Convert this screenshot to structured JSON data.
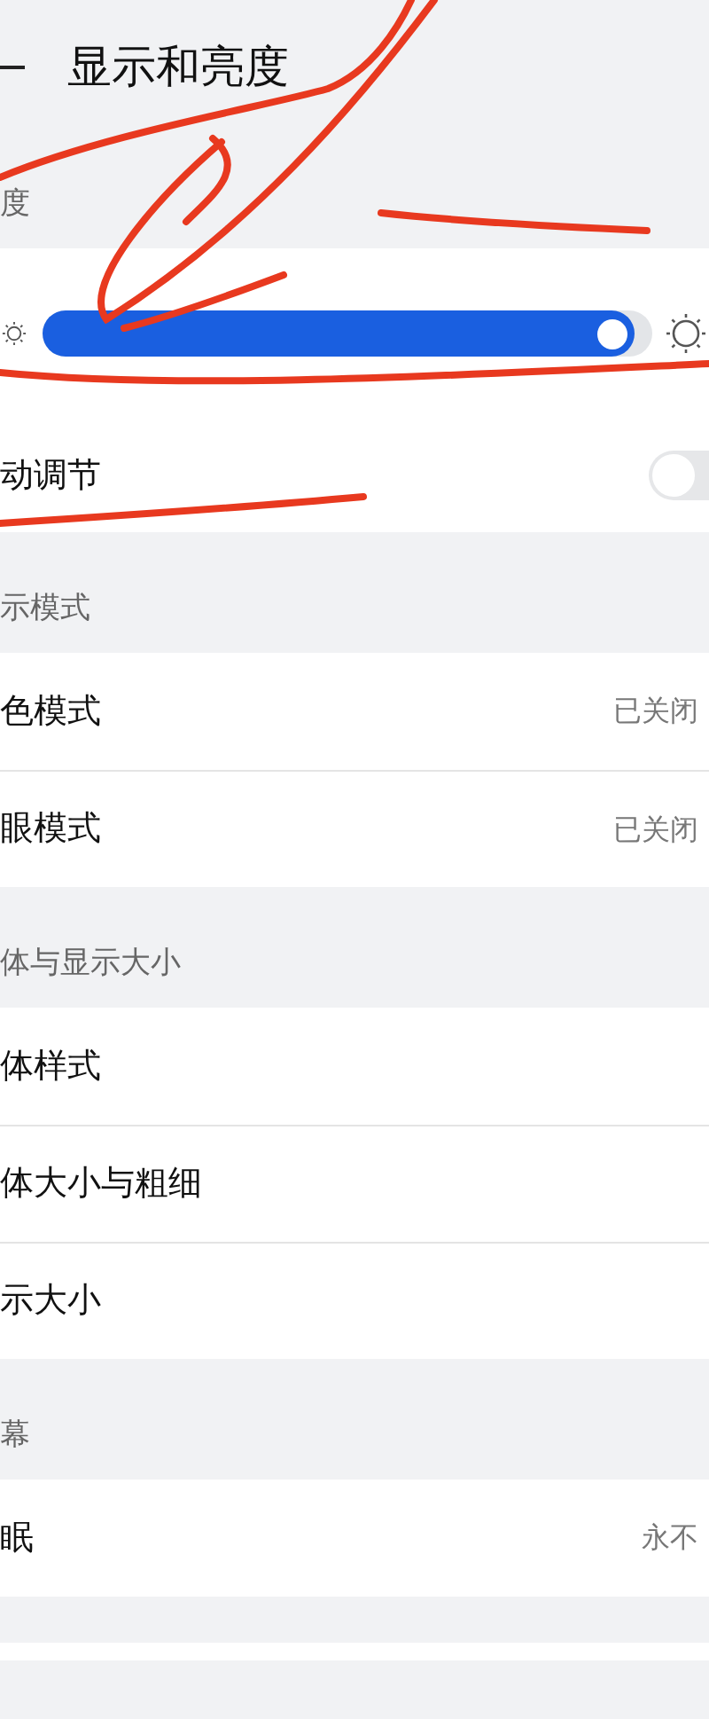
{
  "title": "显示和亮度",
  "brightness": {
    "header": "度",
    "level": 0.97,
    "auto_label": "动调节",
    "auto_on": false
  },
  "sections": [
    {
      "header": "示模式",
      "items": [
        {
          "label": "色模式",
          "value": "已关闭"
        },
        {
          "label": "眼模式",
          "value": "已关闭"
        }
      ]
    },
    {
      "header": "体与显示大小",
      "items": [
        {
          "label": "体样式"
        },
        {
          "label": "体大小与粗细"
        },
        {
          "label": "示大小"
        }
      ]
    },
    {
      "header": "幕",
      "items": [
        {
          "label": "眠",
          "value": "永不"
        }
      ]
    }
  ]
}
